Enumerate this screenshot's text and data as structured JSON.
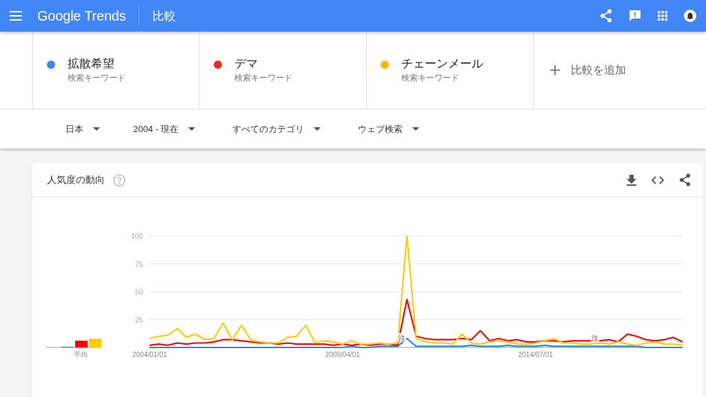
{
  "header": {
    "logo": "Google Trends",
    "title": "比較"
  },
  "terms": [
    {
      "name": "拡散希望",
      "type": "検索キーワード",
      "color": "#4285f4"
    },
    {
      "name": "デマ",
      "type": "検索キーワード",
      "color": "#ea2a1f"
    },
    {
      "name": "チェーンメール",
      "type": "検索キーワード",
      "color": "#fbb804"
    }
  ],
  "add_compare": {
    "label": "比較を追加"
  },
  "filters": [
    {
      "label": "日本"
    },
    {
      "label": "2004 - 現在"
    },
    {
      "label": "すべてのカテゴリ"
    },
    {
      "label": "ウェブ検索"
    }
  ],
  "trend": {
    "title": "人気度の動向",
    "average_label": "平均",
    "chart_data": {
      "type": "line",
      "categories": [
        "2004/01/01",
        null,
        null,
        null,
        null,
        null,
        null,
        null,
        null,
        null,
        null,
        null,
        null,
        null,
        null,
        null,
        null,
        null,
        null,
        null,
        null,
        "2009/04/01",
        null,
        null,
        null,
        null,
        null,
        null,
        null,
        null,
        null,
        null,
        null,
        null,
        null,
        null,
        null,
        null,
        null,
        null,
        null,
        null,
        "2014/07/01",
        null,
        null,
        null,
        null,
        null,
        null,
        null,
        null,
        null,
        null,
        null,
        null,
        null,
        null,
        null,
        null
      ],
      "ylim": [
        0,
        100
      ],
      "yticks": [
        25,
        50,
        75,
        100
      ],
      "series": [
        {
          "color": "#1e88e5",
          "values": [
            0,
            0,
            0,
            0,
            0,
            0,
            0,
            0,
            0,
            0,
            0,
            0,
            0,
            0,
            0,
            0,
            0,
            0,
            0,
            0,
            0,
            0,
            1,
            0,
            0,
            1,
            1,
            1,
            8,
            1,
            1,
            1,
            1,
            1,
            1,
            2,
            1,
            1,
            1,
            2,
            1,
            1,
            1,
            2,
            1,
            1,
            1,
            1,
            1,
            1,
            1,
            1,
            1,
            1,
            0,
            0,
            0,
            0,
            0
          ]
        },
        {
          "color": "#ff0000",
          "values": [
            2,
            3,
            2,
            4,
            3,
            4,
            4,
            5,
            7,
            7,
            6,
            5,
            4,
            4,
            3,
            4,
            3,
            3,
            3,
            3,
            2,
            3,
            2,
            3,
            2,
            3,
            3,
            2,
            43,
            10,
            8,
            7,
            7,
            7,
            8,
            7,
            15,
            6,
            8,
            6,
            7,
            5,
            5,
            6,
            6,
            5,
            6,
            6,
            6,
            6,
            7,
            5,
            12,
            10,
            7,
            6,
            7,
            9,
            5
          ]
        },
        {
          "color": "#ffcc00",
          "values": [
            8,
            10,
            11,
            17,
            9,
            12,
            7,
            8,
            22,
            7,
            20,
            7,
            5,
            4,
            4,
            9,
            10,
            20,
            4,
            6,
            5,
            3,
            6,
            3,
            3,
            4,
            3,
            4,
            100,
            8,
            5,
            4,
            4,
            3,
            12,
            4,
            3,
            5,
            6,
            5,
            3,
            3,
            4,
            6,
            8,
            4,
            4,
            3,
            3,
            4,
            3,
            5,
            3,
            2,
            4,
            5,
            3,
            3,
            2
          ]
        }
      ],
      "grid": true,
      "annotations": [
        {
          "text": "注"
        },
        {
          "text": "注"
        }
      ]
    }
  }
}
